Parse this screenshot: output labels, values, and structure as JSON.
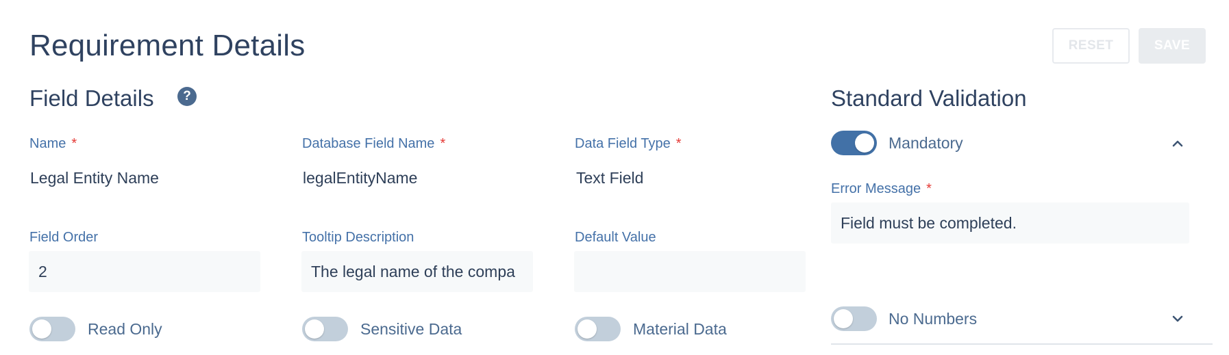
{
  "header": {
    "title": "Requirement Details",
    "reset_label": "RESET",
    "save_label": "SAVE"
  },
  "field_details": {
    "title": "Field Details",
    "help_icon": "question-circle-icon",
    "name": {
      "label": "Name",
      "required": "*",
      "value": "Legal Entity Name"
    },
    "db_field_name": {
      "label": "Database Field Name",
      "required": "*",
      "value": "legalEntityName"
    },
    "data_field_type": {
      "label": "Data Field Type",
      "required": "*",
      "value": "Text Field"
    },
    "field_order": {
      "label": "Field Order",
      "value": "2"
    },
    "tooltip_description": {
      "label": "Tooltip Description",
      "value": "The legal name of the compa"
    },
    "default_value": {
      "label": "Default Value",
      "value": ""
    },
    "read_only": {
      "label": "Read Only",
      "on": false
    },
    "sensitive_data": {
      "label": "Sensitive Data",
      "on": false
    },
    "material_data": {
      "label": "Material Data",
      "on": false
    }
  },
  "standard_validation": {
    "title": "Standard Validation",
    "mandatory": {
      "label": "Mandatory",
      "on": true,
      "expanded": true
    },
    "error_message": {
      "label": "Error Message",
      "required": "*",
      "value": "Field must be completed."
    },
    "no_numbers": {
      "label": "No Numbers",
      "on": false,
      "expanded": false
    }
  },
  "colors": {
    "accent": "#4271a7",
    "label": "#4471a8",
    "required": "#e53935",
    "text": "#2e3f58"
  }
}
